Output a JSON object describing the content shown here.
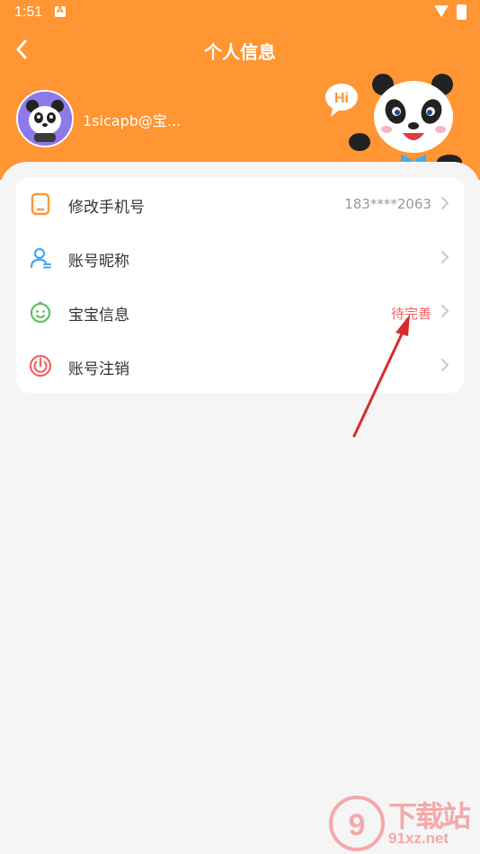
{
  "status_bar": {
    "time": "1:51"
  },
  "header": {
    "title": "个人信息"
  },
  "profile": {
    "username": "1sicapb@宝..."
  },
  "menu": {
    "items": [
      {
        "label": "修改手机号",
        "value": "183****2063",
        "icon": "phone-icon"
      },
      {
        "label": "账号昵称",
        "value": "",
        "icon": "user-icon"
      },
      {
        "label": "宝宝信息",
        "value": "待完善",
        "icon": "baby-face-icon"
      },
      {
        "label": "账号注销",
        "value": "",
        "icon": "power-icon"
      }
    ]
  },
  "mascot": {
    "bubble_text": "Hi"
  },
  "watermark": {
    "site_name": "下载站",
    "url": "91xz.net"
  },
  "colors": {
    "header_bg": "#ff9533",
    "warn": "#f06262",
    "phone_icon": "#ff9533",
    "user_icon": "#3fa9f5",
    "baby_icon": "#5cc45c",
    "power_icon": "#f06262"
  }
}
